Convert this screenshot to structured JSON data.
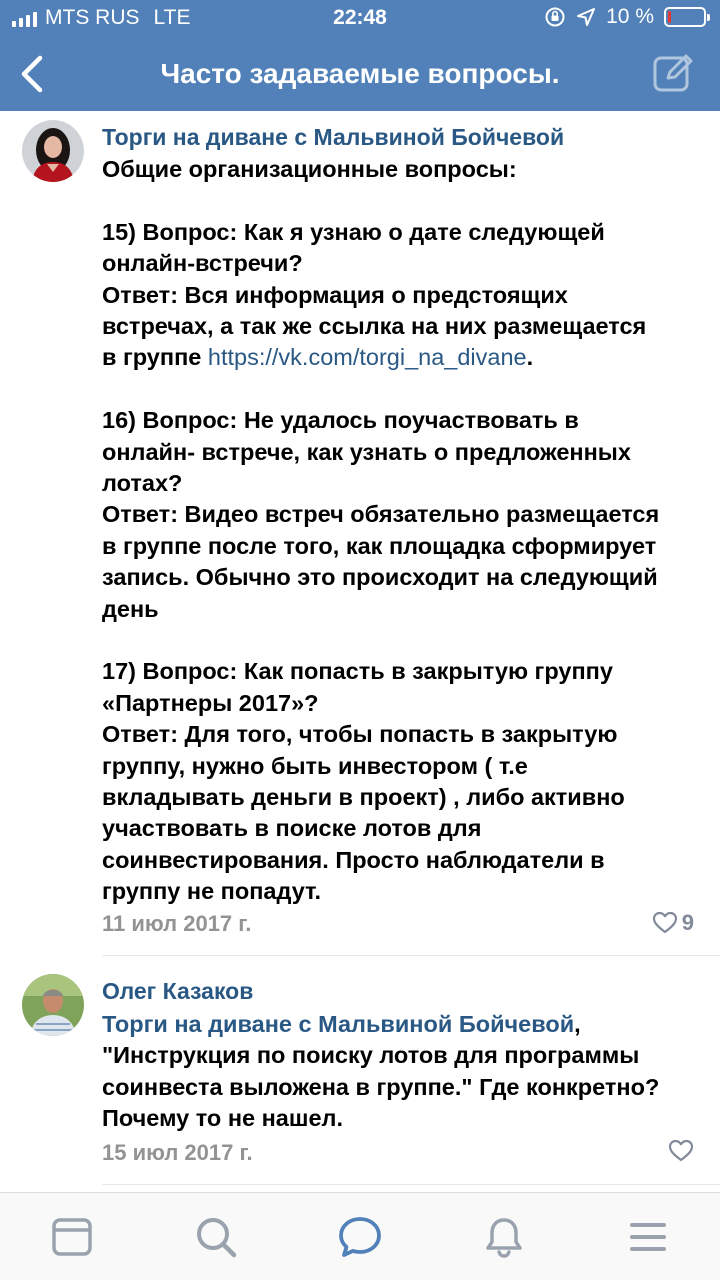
{
  "status_bar": {
    "carrier": "MTS RUS",
    "network": "LTE",
    "time": "22:48",
    "battery": "10 %",
    "battery_level": 0.1
  },
  "nav": {
    "title": "Часто задаваемые вопросы."
  },
  "comments": [
    {
      "author": "Торги на диване с Мальвиной Бойчевой",
      "lines": [
        "Общие организационные вопросы:",
        "",
        "15) Вопрос: Как я узнаю о дате следующей",
        "онлайн-встречи?",
        "Ответ: Вся информация о предстоящих",
        "встречах, а так же ссылка на них размещается"
      ],
      "link_line_prefix": "в группе ",
      "link_text": "https://vk.com/torgi_na_divane",
      "link_line_suffix": ".",
      "lines_after": [
        "",
        "16) Вопрос: Не удалось поучаствовать в",
        "онлайн- встрече, как узнать о предложенных",
        "лотах?",
        "Ответ: Видео встреч обязательно размещается",
        "в группе после того, как площадка сформирует",
        "запись. Обычно это происходит на следующий",
        "день",
        "",
        "17) Вопрос: Как попасть в закрытую группу",
        "«Партнеры 2017»?",
        "Ответ: Для того, чтобы попасть в закрытую",
        "группу, нужно быть инвестором ( т.е",
        "вкладывать деньги в проект) , либо активно",
        "участвовать в поиске лотов для",
        "соинвестирования. Просто наблюдатели в",
        "группу не попадут."
      ],
      "date": "11 июл 2017 г.",
      "likes": "9"
    },
    {
      "author": "Олег Казаков",
      "mention": "Торги на диване с Мальвиной Бойчевой",
      "mention_suffix": ",",
      "lines": [
        "\"Инструкция по поиску лотов для программы",
        "соинвеста выложена в группе.\" Где конкретно?",
        "Почему то не нашел."
      ],
      "date": "15 июл 2017 г."
    }
  ],
  "tabbar": {
    "items": [
      {
        "icon": "news-icon"
      },
      {
        "icon": "search-icon"
      },
      {
        "icon": "messages-icon"
      },
      {
        "icon": "notifications-icon"
      },
      {
        "icon": "menu-icon"
      }
    ]
  },
  "colors": {
    "header": "#5181b8",
    "link": "#2a5885",
    "meta": "#939393",
    "tab_icon": "#99a2ad",
    "tab_active": "#5181b8"
  }
}
